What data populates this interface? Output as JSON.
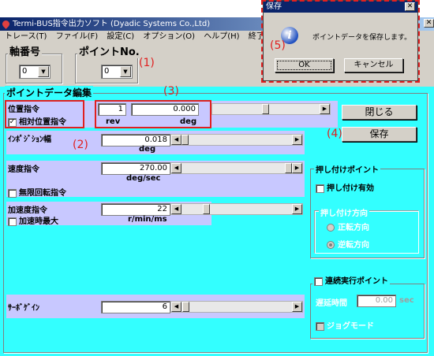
{
  "window": {
    "title": "Termi-BUS指令出力ソフト (Dyadic Systems Co.,Ltd)"
  },
  "menu": [
    "トレース(T)",
    "ファイル(F)",
    "設定(C)",
    "オプション(O)",
    "ヘルプ(H)",
    "終了(X)"
  ],
  "axis": {
    "label": "軸番号",
    "value": "0"
  },
  "point": {
    "label": "ポイントNo.",
    "value": "0"
  },
  "annotations": {
    "a1": "(1)",
    "a2": "(2)",
    "a3": "(3)",
    "a4": "(4)",
    "a5": "(5)"
  },
  "section": {
    "title": "ポイントデータ編集"
  },
  "position": {
    "label": "位置指令",
    "relative_label": "相対位置指令",
    "relative_checked": true,
    "rev_value": "1",
    "rev_unit": "rev",
    "deg_value": "0.000",
    "deg_unit": "deg"
  },
  "inposition": {
    "label": "ｲﾝﾎﾟｼﾞｼｮﾝ幅",
    "value": "0.018",
    "unit": "deg"
  },
  "speed": {
    "label": "速度指令",
    "value": "270.00",
    "unit": "deg/sec",
    "infinite_label": "無限回転指令"
  },
  "accel": {
    "label": "加速度指令",
    "value": "22",
    "unit": "r/min/ms",
    "max_label": "加速時最大"
  },
  "servo": {
    "label": "ｻｰﾎﾞｹﾞｲﾝ",
    "value": "6"
  },
  "buttons": {
    "close": "閉じる",
    "save": "保存"
  },
  "push": {
    "title": "押し付けポイント",
    "enable_label": "押し付け有効",
    "dir_title": "押し付け方向",
    "forward": "正転方向",
    "reverse": "逆転方向"
  },
  "continuous": {
    "title": "連続実行ポイント",
    "delay_label": "遅延時間",
    "delay_value": "0.00",
    "delay_unit": "sec",
    "jog_label": "ジョグモード"
  },
  "dialog": {
    "title": "保存",
    "message": "ポイントデータを保存します。",
    "ok": "OK",
    "cancel": "キャンセル"
  }
}
